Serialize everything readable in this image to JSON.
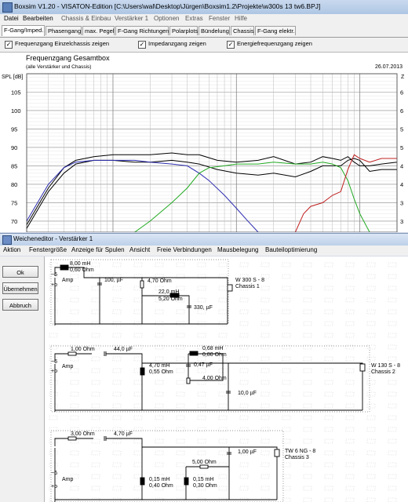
{
  "titlebar": {
    "title": "Boxsim V1.20 - VISATON-Edition [C:\\Users\\wal\\Desktop\\Jürgen\\Boxsim1.2\\Projekte\\w300s 13 tw6.BPJ]"
  },
  "menu": [
    "Datei",
    "Bearbeiten",
    "Chassis & Einbau",
    "Verstärker 1",
    "Optionen",
    "Extras",
    "Fenster",
    "Hilfe"
  ],
  "tabs": [
    "F-Gang/Imped.",
    "Phasengang",
    "max. Pegel",
    "F-Gang Richtungen",
    "Polarplots",
    "Bündelung",
    "Chassis",
    "F-Gang elektr."
  ],
  "checkboxes": [
    {
      "label": "Frequenzgang Einzelchassis zeigen",
      "checked": true
    },
    {
      "label": "Impedanzgang zeigen",
      "checked": true
    },
    {
      "label": "Energiefrequenzgang zeigen",
      "checked": true
    }
  ],
  "chart": {
    "title": "Frequenzgang Gesamtbox",
    "subtitle": "(alle Verstärker und Chassis)",
    "date": "26.07.2013",
    "ylabel": "SPL [dB]",
    "ylabel_right": "Z",
    "yticks": [
      "105",
      "100",
      "95",
      "90",
      "85",
      "80",
      "75",
      "70"
    ],
    "yticks_right": [
      "6",
      "6",
      "5",
      "5",
      "4",
      "4",
      "3",
      "3"
    ]
  },
  "chart_data": {
    "type": "line",
    "title": "Frequenzgang Gesamtbox",
    "subtitle": "(alle Verstärker und Chassis)",
    "ylabel": "SPL [dB]",
    "xscale": "log",
    "xlim": [
      20,
      20000
    ],
    "ylim": [
      67,
      110
    ],
    "grid": true,
    "series": [
      {
        "color": "#000000",
        "x": [
          20,
          30,
          40,
          50,
          70,
          100,
          150,
          200,
          300,
          400,
          500,
          700,
          1000,
          1500,
          2000,
          3000,
          4000,
          5000,
          6000,
          7000,
          8000,
          9000,
          10000,
          12000,
          15000,
          20000
        ],
        "y": [
          68,
          78,
          83,
          85.5,
          86.5,
          86.5,
          86,
          86,
          86.5,
          86,
          85.5,
          84,
          83,
          82.5,
          83,
          82,
          83.5,
          85,
          85,
          85,
          86.5,
          87,
          86.5,
          83.5,
          84,
          84
        ]
      },
      {
        "color": "#000000",
        "x": [
          20,
          30,
          40,
          50,
          70,
          100,
          150,
          200,
          300,
          400,
          500,
          700,
          1000,
          1500,
          2000,
          3000,
          4000,
          5000,
          6000,
          7000,
          8000,
          9000,
          10000,
          12000,
          15000,
          20000
        ],
        "y": [
          69,
          79,
          84.5,
          86.5,
          87.5,
          88,
          88,
          88,
          88.5,
          88,
          88,
          86.5,
          86,
          86.5,
          87.5,
          85.5,
          86,
          87.5,
          87,
          86.5,
          87.5,
          86,
          85,
          85,
          85.5,
          86
        ]
      },
      {
        "color": "#2b2bb0",
        "x": [
          20,
          30,
          40,
          50,
          70,
          100,
          150,
          200,
          300,
          400,
          500,
          600,
          800,
          1000,
          1200,
          1500
        ],
        "y": [
          70,
          80,
          84.5,
          86,
          86.5,
          86.5,
          86.5,
          86,
          85.5,
          85,
          83,
          81,
          77,
          73.5,
          70.5,
          67
        ]
      },
      {
        "color": "#22aa22",
        "x": [
          150,
          200,
          300,
          400,
          500,
          600,
          800,
          1000,
          1500,
          2000,
          3000,
          4000,
          5000,
          6000,
          7000,
          8000,
          9000,
          10000,
          12000
        ],
        "y": [
          67,
          70,
          75,
          79,
          83,
          84.5,
          85,
          85.5,
          85.5,
          86,
          85.5,
          85.5,
          86,
          85.5,
          84.5,
          81,
          76,
          72,
          67
        ]
      },
      {
        "color": "#c02020",
        "x": [
          3000,
          3500,
          4000,
          5000,
          6000,
          7000,
          8000,
          9000,
          10000,
          12000,
          15000,
          20000
        ],
        "y": [
          67,
          72,
          74,
          75,
          77,
          78,
          84,
          88,
          87,
          86,
          87,
          87
        ]
      }
    ]
  },
  "dialog": {
    "title": "Weicheneditor - Verstärker 1"
  },
  "dialog_menu": [
    "Aktion",
    "Fenstergröße",
    "Anzeige für Spulen",
    "Ansicht",
    "Freie Verbindungen",
    "Mausbelegung",
    "Bauteiloptimierung"
  ],
  "buttons": {
    "ok": "Ok",
    "apply": "Übernehmen",
    "cancel": "Abbruch"
  },
  "circuits": [
    {
      "amp": "Amp",
      "parts": [
        "8,00 mH",
        "0,60 Ohm",
        "100, µF",
        "4,70 Ohm",
        "22,0 mH",
        "5,20 Ohm",
        "330, µF"
      ],
      "chassis": [
        "W 300 S - 8",
        "Chassis 1"
      ]
    },
    {
      "amp": "Amp",
      "parts": [
        "1,00 Ohm",
        "44,0 µF",
        "4,70 mH",
        "0,55 Ohm",
        "0,68 mH",
        "0,80 Ohm",
        "0,47 µF",
        "4,00 Ohm",
        "10,0 µF"
      ],
      "chassis": [
        "W 130 S - 8",
        "Chassis 2"
      ]
    },
    {
      "amp": "Amp",
      "parts": [
        "3,00 Ohm",
        "4,70 µF",
        "1,00 µF",
        "5,00 Ohm",
        "0,15 mH",
        "0,40 Ohm",
        "0,15 mH",
        "0,30 Ohm"
      ],
      "chassis": [
        "TW 6 NG - 8",
        "Chassis 3"
      ]
    }
  ],
  "terminal_minus": "−6",
  "terminal_plus": "+o"
}
